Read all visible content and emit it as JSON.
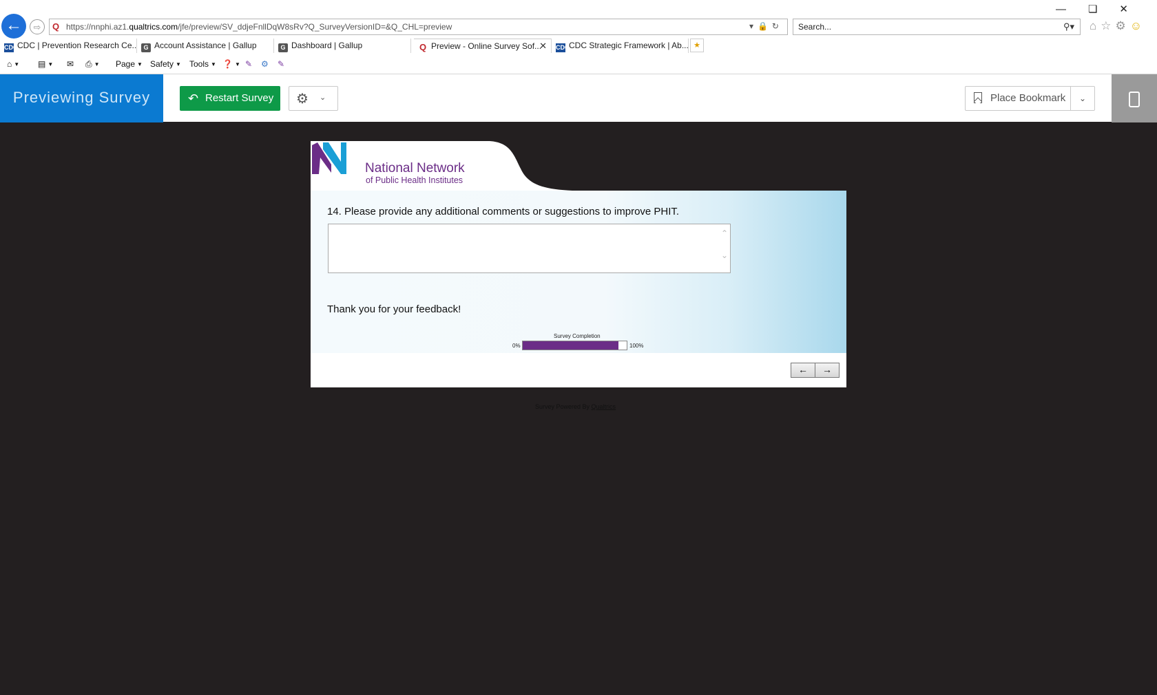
{
  "browser": {
    "url_prefix": "https://nnphi.az1.",
    "url_domain": "qualtrics.com",
    "url_path": "/jfe/preview/SV_ddjeFnllDqW8sRv?Q_SurveyVersionID=&Q_CHL=preview",
    "search_placeholder": "Search...",
    "tabs": [
      {
        "label": "CDC | Prevention Research Ce...",
        "icon": "cdc-icon"
      },
      {
        "label": "Account Assistance | Gallup",
        "icon": "gallup-icon"
      },
      {
        "label": "Dashboard | Gallup",
        "icon": "gallup-icon"
      },
      {
        "label": "Preview - Online Survey Sof...",
        "icon": "qualtrics-icon",
        "active": true
      },
      {
        "label": "CDC Strategic Framework | Ab...",
        "icon": "cdc-icon"
      }
    ],
    "command_bar": {
      "page": "Page",
      "safety": "Safety",
      "tools": "Tools"
    }
  },
  "preview_bar": {
    "title": "Previewing Survey",
    "restart_label": "Restart Survey",
    "bookmark_label": "Place Bookmark",
    "accent_color": "#0b7ad1",
    "restart_color": "#0e9a48"
  },
  "survey": {
    "logo_line1": "National Network",
    "logo_line2": "of Public Health Institutes",
    "question": "14. Please provide any additional comments or suggestions to improve PHIT.",
    "answer_value": "",
    "thanks": "Thank you for your feedback!",
    "progress_label": "Survey Completion",
    "progress_min": "0%",
    "progress_max": "100%",
    "progress_fraction": 0.92,
    "progress_color": "#6b2d87",
    "back_label": "←",
    "next_label": "→",
    "powered_by": "Survey Powered By ",
    "powered_link": "Qualtrics"
  }
}
